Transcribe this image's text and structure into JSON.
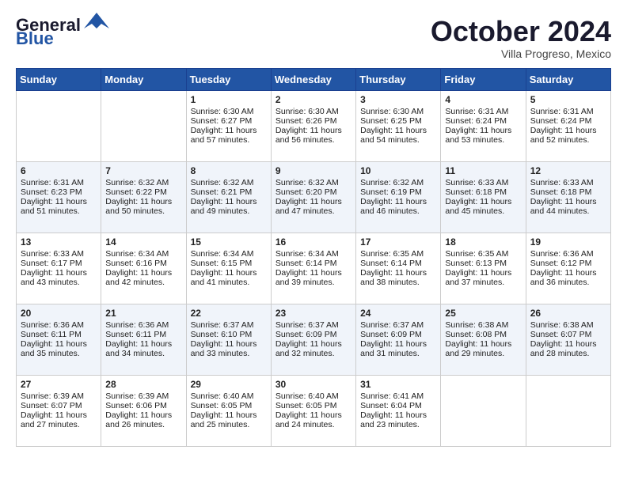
{
  "header": {
    "logo_line1": "General",
    "logo_line2": "Blue",
    "month_title": "October 2024",
    "location": "Villa Progreso, Mexico"
  },
  "weekdays": [
    "Sunday",
    "Monday",
    "Tuesday",
    "Wednesday",
    "Thursday",
    "Friday",
    "Saturday"
  ],
  "weeks": [
    [
      {
        "day": "",
        "content": ""
      },
      {
        "day": "",
        "content": ""
      },
      {
        "day": "1",
        "content": "Sunrise: 6:30 AM\nSunset: 6:27 PM\nDaylight: 11 hours and 57 minutes."
      },
      {
        "day": "2",
        "content": "Sunrise: 6:30 AM\nSunset: 6:26 PM\nDaylight: 11 hours and 56 minutes."
      },
      {
        "day": "3",
        "content": "Sunrise: 6:30 AM\nSunset: 6:25 PM\nDaylight: 11 hours and 54 minutes."
      },
      {
        "day": "4",
        "content": "Sunrise: 6:31 AM\nSunset: 6:24 PM\nDaylight: 11 hours and 53 minutes."
      },
      {
        "day": "5",
        "content": "Sunrise: 6:31 AM\nSunset: 6:24 PM\nDaylight: 11 hours and 52 minutes."
      }
    ],
    [
      {
        "day": "6",
        "content": "Sunrise: 6:31 AM\nSunset: 6:23 PM\nDaylight: 11 hours and 51 minutes."
      },
      {
        "day": "7",
        "content": "Sunrise: 6:32 AM\nSunset: 6:22 PM\nDaylight: 11 hours and 50 minutes."
      },
      {
        "day": "8",
        "content": "Sunrise: 6:32 AM\nSunset: 6:21 PM\nDaylight: 11 hours and 49 minutes."
      },
      {
        "day": "9",
        "content": "Sunrise: 6:32 AM\nSunset: 6:20 PM\nDaylight: 11 hours and 47 minutes."
      },
      {
        "day": "10",
        "content": "Sunrise: 6:32 AM\nSunset: 6:19 PM\nDaylight: 11 hours and 46 minutes."
      },
      {
        "day": "11",
        "content": "Sunrise: 6:33 AM\nSunset: 6:18 PM\nDaylight: 11 hours and 45 minutes."
      },
      {
        "day": "12",
        "content": "Sunrise: 6:33 AM\nSunset: 6:18 PM\nDaylight: 11 hours and 44 minutes."
      }
    ],
    [
      {
        "day": "13",
        "content": "Sunrise: 6:33 AM\nSunset: 6:17 PM\nDaylight: 11 hours and 43 minutes."
      },
      {
        "day": "14",
        "content": "Sunrise: 6:34 AM\nSunset: 6:16 PM\nDaylight: 11 hours and 42 minutes."
      },
      {
        "day": "15",
        "content": "Sunrise: 6:34 AM\nSunset: 6:15 PM\nDaylight: 11 hours and 41 minutes."
      },
      {
        "day": "16",
        "content": "Sunrise: 6:34 AM\nSunset: 6:14 PM\nDaylight: 11 hours and 39 minutes."
      },
      {
        "day": "17",
        "content": "Sunrise: 6:35 AM\nSunset: 6:14 PM\nDaylight: 11 hours and 38 minutes."
      },
      {
        "day": "18",
        "content": "Sunrise: 6:35 AM\nSunset: 6:13 PM\nDaylight: 11 hours and 37 minutes."
      },
      {
        "day": "19",
        "content": "Sunrise: 6:36 AM\nSunset: 6:12 PM\nDaylight: 11 hours and 36 minutes."
      }
    ],
    [
      {
        "day": "20",
        "content": "Sunrise: 6:36 AM\nSunset: 6:11 PM\nDaylight: 11 hours and 35 minutes."
      },
      {
        "day": "21",
        "content": "Sunrise: 6:36 AM\nSunset: 6:11 PM\nDaylight: 11 hours and 34 minutes."
      },
      {
        "day": "22",
        "content": "Sunrise: 6:37 AM\nSunset: 6:10 PM\nDaylight: 11 hours and 33 minutes."
      },
      {
        "day": "23",
        "content": "Sunrise: 6:37 AM\nSunset: 6:09 PM\nDaylight: 11 hours and 32 minutes."
      },
      {
        "day": "24",
        "content": "Sunrise: 6:37 AM\nSunset: 6:09 PM\nDaylight: 11 hours and 31 minutes."
      },
      {
        "day": "25",
        "content": "Sunrise: 6:38 AM\nSunset: 6:08 PM\nDaylight: 11 hours and 29 minutes."
      },
      {
        "day": "26",
        "content": "Sunrise: 6:38 AM\nSunset: 6:07 PM\nDaylight: 11 hours and 28 minutes."
      }
    ],
    [
      {
        "day": "27",
        "content": "Sunrise: 6:39 AM\nSunset: 6:07 PM\nDaylight: 11 hours and 27 minutes."
      },
      {
        "day": "28",
        "content": "Sunrise: 6:39 AM\nSunset: 6:06 PM\nDaylight: 11 hours and 26 minutes."
      },
      {
        "day": "29",
        "content": "Sunrise: 6:40 AM\nSunset: 6:05 PM\nDaylight: 11 hours and 25 minutes."
      },
      {
        "day": "30",
        "content": "Sunrise: 6:40 AM\nSunset: 6:05 PM\nDaylight: 11 hours and 24 minutes."
      },
      {
        "day": "31",
        "content": "Sunrise: 6:41 AM\nSunset: 6:04 PM\nDaylight: 11 hours and 23 minutes."
      },
      {
        "day": "",
        "content": ""
      },
      {
        "day": "",
        "content": ""
      }
    ]
  ]
}
